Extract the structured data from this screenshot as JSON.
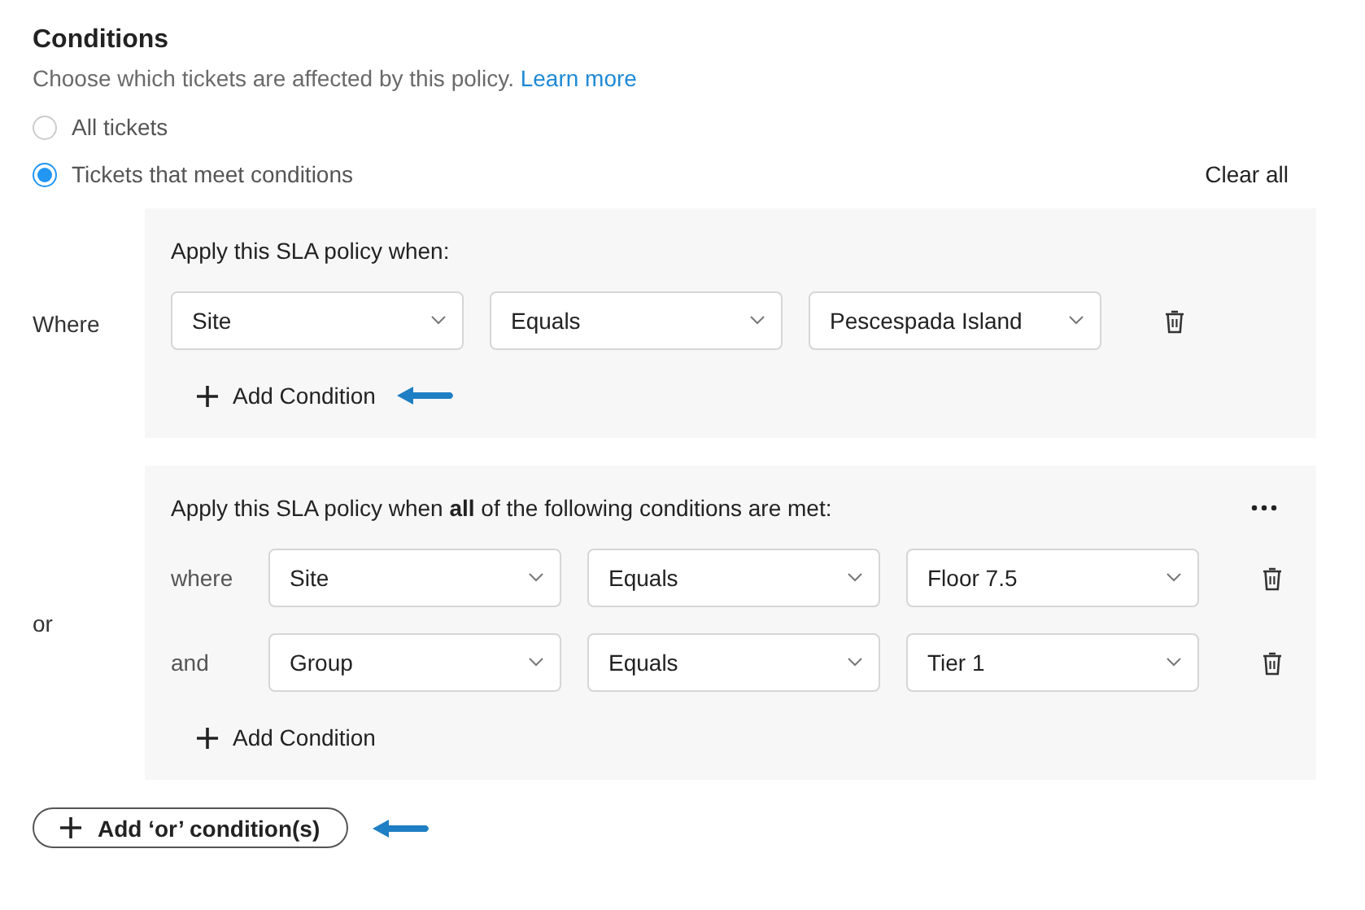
{
  "heading": "Conditions",
  "description": "Choose which tickets are affected by this policy.",
  "learn_more": "Learn more",
  "scope_options": [
    {
      "label": "All tickets",
      "selected": false
    },
    {
      "label": "Tickets that meet conditions",
      "selected": true
    }
  ],
  "clear_all": "Clear all",
  "groups": [
    {
      "label": "Where",
      "title": "Apply this SLA policy when:",
      "more_menu": false,
      "add_condition": "Add Condition",
      "add_highlighted": true,
      "rows": [
        {
          "field": "Site",
          "operator": "Equals",
          "value": "Pescespada Island"
        }
      ]
    },
    {
      "label": "or",
      "title": "Apply this SLA policy when **all** of the following conditions are met:",
      "more_menu": true,
      "add_condition": "Add Condition",
      "add_highlighted": false,
      "rows": [
        {
          "connector": "where",
          "field": "Site",
          "operator": "Equals",
          "value": "Floor 7.5"
        },
        {
          "connector": "and",
          "field": "Group",
          "operator": "Equals",
          "value": "Tier 1"
        }
      ]
    }
  ],
  "add_or": {
    "label": "Add ‘or’ condition(s)",
    "highlighted": true
  }
}
